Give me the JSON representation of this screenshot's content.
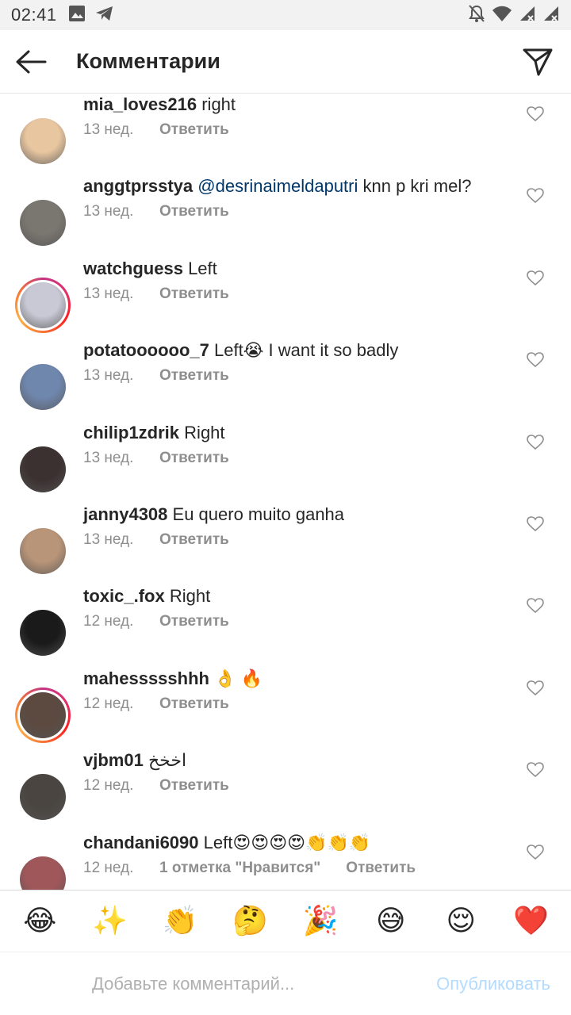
{
  "status_bar": {
    "time": "02:41",
    "left_icons": [
      "image-icon",
      "telegram-icon"
    ],
    "right_icons": [
      "mute-icon",
      "wifi-icon",
      "signal-icon",
      "signal-icon"
    ]
  },
  "header": {
    "title": "Комментарии"
  },
  "comments": [
    {
      "username": "mia_loves216",
      "mention": "",
      "text": "right",
      "time": "13 нед.",
      "likes": "",
      "reply": "Ответить",
      "avatar_color": "#e8c6a0",
      "ring": false
    },
    {
      "username": "anggtprsstya",
      "mention": "@desrinaimeldaputri",
      "text": "knn p kri mel?",
      "time": "13 нед.",
      "likes": "",
      "reply": "Ответить",
      "avatar_color": "#7a7670",
      "ring": false
    },
    {
      "username": "watchguess",
      "mention": "",
      "text": "Left",
      "time": "13 нед.",
      "likes": "",
      "reply": "Ответить",
      "avatar_color": "#c9c9d6",
      "ring": true
    },
    {
      "username": "potatoooooo_7",
      "mention": "",
      "text": "Left😭 I want it so badly",
      "time": "13 нед.",
      "likes": "",
      "reply": "Ответить",
      "avatar_color": "#6f86ad",
      "ring": false
    },
    {
      "username": "chilip1zdrik",
      "mention": "",
      "text": "Right",
      "time": "13 нед.",
      "likes": "",
      "reply": "Ответить",
      "avatar_color": "#3b3130",
      "ring": false
    },
    {
      "username": "janny4308",
      "mention": "",
      "text": "Eu quero muito ganha",
      "time": "13 нед.",
      "likes": "",
      "reply": "Ответить",
      "avatar_color": "#b89478",
      "ring": false
    },
    {
      "username": "toxic_.fox",
      "mention": "",
      "text": "Right",
      "time": "12 нед.",
      "likes": "",
      "reply": "Ответить",
      "avatar_color": "#1a1a1a",
      "ring": false
    },
    {
      "username": "mahessssshhh",
      "mention": "",
      "text": "👌 🔥",
      "time": "12 нед.",
      "likes": "",
      "reply": "Ответить",
      "avatar_color": "#5c4a40",
      "ring": true
    },
    {
      "username": "vjbm01",
      "mention": "",
      "text": "اخخخ",
      "time": "12 нед.",
      "likes": "",
      "reply": "Ответить",
      "avatar_color": "#4a4540",
      "ring": false
    },
    {
      "username": "chandani6090",
      "mention": "",
      "text": "Left😍😍😍😍👏👏👏",
      "time": "12 нед.",
      "likes": "1 отметка \"Нравится\"",
      "reply": "Ответить",
      "avatar_color": "#a0575a",
      "ring": false
    }
  ],
  "emoji_bar": [
    "😂",
    "✨",
    "👏",
    "🤔",
    "🎉",
    "😅",
    "😌",
    "❤️"
  ],
  "input": {
    "placeholder": "Добавьте комментарий...",
    "value": "",
    "publish_label": "Опубликовать"
  },
  "colors": {
    "accent": "#0095f6",
    "publish_disabled": "#b3dbff",
    "meta_gray": "#8e8e8e",
    "mention": "#00376b"
  }
}
